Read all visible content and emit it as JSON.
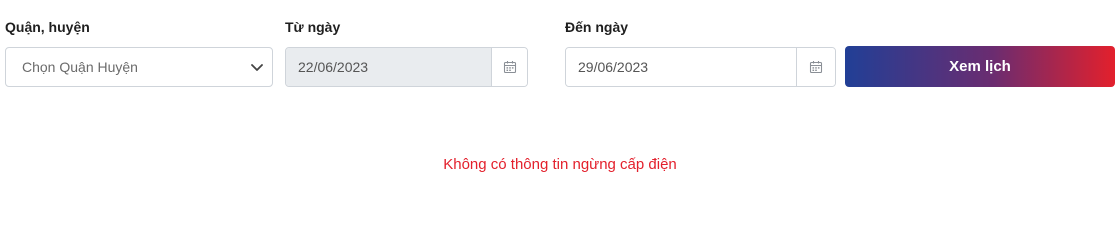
{
  "filters": {
    "district": {
      "label": "Quận, huyện",
      "selected": "Chọn Quận Huyện"
    },
    "from_date": {
      "label": "Từ ngày",
      "value": "22/06/2023"
    },
    "to_date": {
      "label": "Đến ngày",
      "value": "29/06/2023"
    },
    "submit_label": "Xem lịch"
  },
  "result": {
    "empty_message": "Không có thông tin ngừng cấp điện"
  },
  "colors": {
    "accent_start": "#213f96",
    "accent_end": "#e3202c",
    "message": "#e3202c"
  },
  "icons": {
    "district_dropdown": "chevron-down-icon",
    "date_picker": "calendar-icon"
  }
}
